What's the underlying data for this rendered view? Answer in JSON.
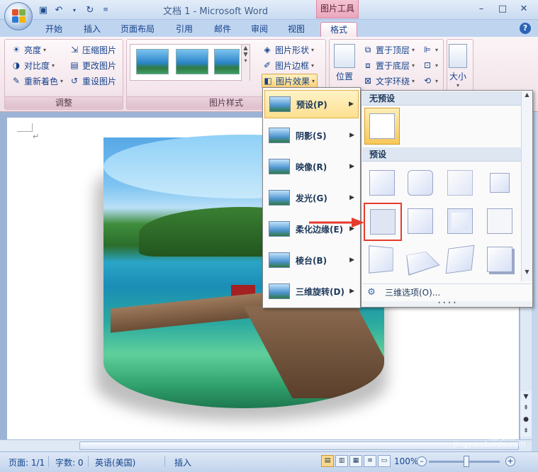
{
  "titlebar": {
    "title": "文档 1 - Microsoft Word",
    "context_tab_title": "图片工具"
  },
  "tabs": [
    "开始",
    "插入",
    "页面布局",
    "引用",
    "邮件",
    "审阅",
    "视图",
    "格式"
  ],
  "ribbon": {
    "adjust": {
      "brightness": "亮度",
      "contrast": "对比度",
      "recolor": "重新着色",
      "compress": "压缩图片",
      "change": "更改图片",
      "reset": "重设图片",
      "label": "调整"
    },
    "styles": {
      "label": "图片样式",
      "shape": "图片形状",
      "border": "图片边框",
      "effects": "图片效果"
    },
    "arrange": {
      "position": "位置",
      "bring_front": "置于顶层",
      "send_back": "置于底层",
      "text_wrap": "文字环绕"
    },
    "size": {
      "label": "大小"
    }
  },
  "effects_menu": [
    {
      "label": "预设(P)"
    },
    {
      "label": "阴影(S)"
    },
    {
      "label": "映像(R)"
    },
    {
      "label": "发光(G)"
    },
    {
      "label": "柔化边缘(E)"
    },
    {
      "label": "棱台(B)"
    },
    {
      "label": "三维旋转(D)"
    }
  ],
  "preset_pane": {
    "no_preset_heading": "无预设",
    "preset_heading": "预设",
    "footer": "三维选项(O)..."
  },
  "status": {
    "page": "页面: 1/1",
    "words": "字数: 0",
    "language": "英语(美国)",
    "insert_mode": "插入",
    "zoom": "100%"
  },
  "watermark": {
    "brand": "Baidu 经验",
    "url": "jingyan.baidu.com"
  },
  "colors": {
    "accent_context": "#eaa7bd",
    "highlight": "#fddf8f",
    "arrow": "#e63b2e"
  }
}
